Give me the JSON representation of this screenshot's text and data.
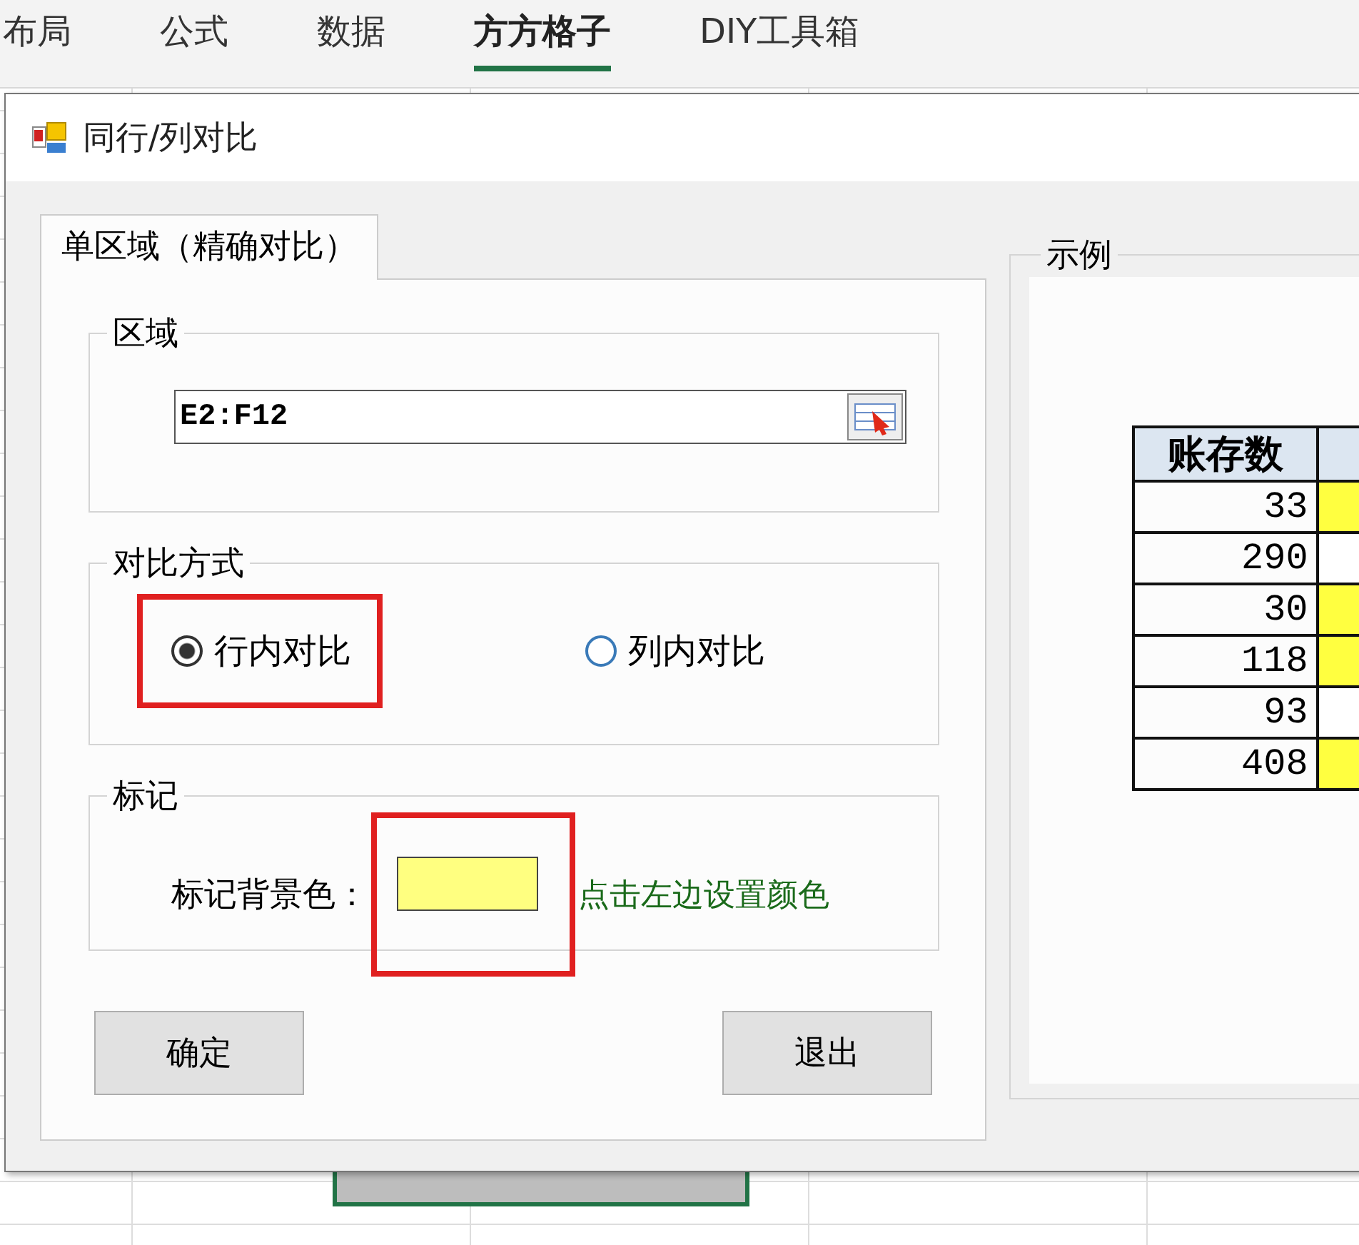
{
  "ribbon": {
    "tabs": [
      {
        "label": "布局",
        "selected": false
      },
      {
        "label": "公式",
        "selected": false
      },
      {
        "label": "数据",
        "selected": false
      },
      {
        "label": "方方格子",
        "selected": true
      },
      {
        "label": "DIY工具箱",
        "selected": false
      }
    ]
  },
  "dialog": {
    "title": "同行/列对比",
    "tab": "单区域（精确对比）",
    "range_group": {
      "label": "区域",
      "value": "E2:F12"
    },
    "mode_group": {
      "label": "对比方式",
      "options": [
        {
          "label": "行内对比",
          "selected": true,
          "highlighted": true
        },
        {
          "label": "列内对比",
          "selected": false,
          "highlighted": false
        }
      ]
    },
    "mark_group": {
      "label": "标记",
      "field_label": "标记背景色：",
      "color": "#ffff80",
      "highlighted": true,
      "hint": "点击左边设置颜色"
    },
    "buttons": [
      "确定",
      "退出"
    ],
    "example": {
      "label": "示例",
      "header": "账存数",
      "rows": [
        {
          "value": "33",
          "marked": true
        },
        {
          "value": "290",
          "marked": false
        },
        {
          "value": "30",
          "marked": true
        },
        {
          "value": "118",
          "marked": true
        },
        {
          "value": "93",
          "marked": false
        },
        {
          "value": "408",
          "marked": true
        }
      ]
    }
  }
}
